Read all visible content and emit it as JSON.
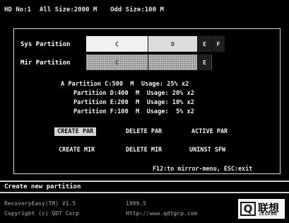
{
  "header": {
    "hd": "HD No:1",
    "all_size": "All Size:2000 M",
    "odd_size": "Odd Size:100 M"
  },
  "partition_bars": {
    "sys_label": "Sys Partition",
    "mir_label": "Mir Partition",
    "sys_segments": [
      "C",
      "D",
      "E",
      "F"
    ],
    "mir_segments": [
      "C",
      "E"
    ]
  },
  "partitions": [
    {
      "name": "A Partition",
      "drive": "C:",
      "size": "500",
      "unit": "M",
      "usage_label": "Usage:",
      "usage": "25%",
      "mult": "x2"
    },
    {
      "name": "Partition",
      "drive": "D:",
      "size": "400",
      "unit": "M",
      "usage_label": "Usage:",
      "usage": "20%",
      "mult": "x2"
    },
    {
      "name": "Partition",
      "drive": "E:",
      "size": "200",
      "unit": "M",
      "usage_label": "Usage:",
      "usage": "10%",
      "mult": "x2"
    },
    {
      "name": "Partition",
      "drive": "F:",
      "size": "100",
      "unit": "M",
      "usage_label": "Usage:",
      "usage": "5%",
      "mult": "x2"
    }
  ],
  "actions": {
    "create_par": "CREATE PAR",
    "delete_par": "DELETE PAR",
    "active_par": "ACTIVE PAR",
    "create_mir": "CREATE MIR",
    "delete_mir": "DELETE MIR",
    "uninst_sfw": "UNINST SFW"
  },
  "hint": "F12:to mirror-menu, ESC:exit",
  "status": "Create new partition",
  "footer": {
    "product": "RecoveryEasy(TM) V1.5",
    "year": "1999.5",
    "copyright": "Copyright (c) QDT Corp",
    "url": "Http://www.qdtgrp.com"
  },
  "logo": {
    "mark": "Q",
    "text": "联想",
    "sub": "LEGEND"
  },
  "colors": {
    "background": "#000000",
    "text": "#e6e6e6",
    "selected_button": "#d7d7d7",
    "footer_text": "#7c7c7c"
  }
}
